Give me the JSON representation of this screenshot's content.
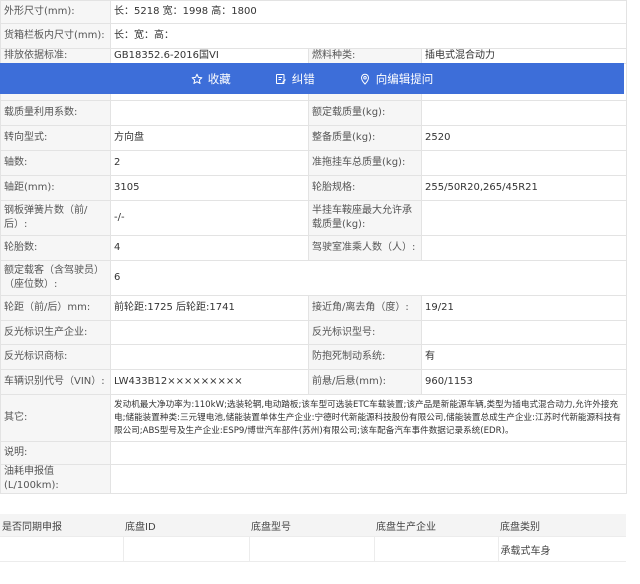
{
  "rows": [
    {
      "l1": "外形尺寸(mm):",
      "v1": "长：5218 宽：1998 高：1800"
    },
    {
      "l1": "货箱栏板内尺寸(mm):",
      "v1": "长：宽：高："
    },
    {
      "l1": "排放依据标准:",
      "v1": "GB18352.6-2016国VI",
      "l2": "燃料种类:",
      "v2": "插电式混合动力"
    },
    {
      "l1": "",
      "v1": "",
      "l2": "",
      "v2": ""
    },
    {
      "l1": "载质量利用系数:",
      "v1": "",
      "l2": "额定载质量(kg):",
      "v2": ""
    },
    {
      "l1": "转向型式:",
      "v1": "方向盘",
      "l2": "整备质量(kg):",
      "v2": "2520"
    },
    {
      "l1": "轴数:",
      "v1": "2",
      "l2": "准拖挂车总质量(kg):",
      "v2": ""
    },
    {
      "l1": "轴距(mm):",
      "v1": "3105",
      "l2": "轮胎规格:",
      "v2": "255/50R20,265/45R21"
    },
    {
      "l1": "钢板弹簧片数（前/后）:",
      "v1": "-/-",
      "l2": "半挂车鞍座最大允许承载质量(kg):",
      "v2": ""
    },
    {
      "l1": "轮胎数:",
      "v1": "4",
      "l2": "驾驶室准乘人数（人）:",
      "v2": ""
    },
    {
      "l1": "额定载客（含驾驶员）（座位数）:",
      "v1": "6"
    },
    {
      "l1": "轮距（前/后）mm:",
      "v1": "前轮距:1725 后轮距:1741",
      "l2": "接近角/离去角（度）:",
      "v2": "19/21"
    },
    {
      "l1": "反光标识生产企业:",
      "v1": "",
      "l2": "反光标识型号:",
      "v2": ""
    },
    {
      "l1": "反光标识商标:",
      "v1": "",
      "l2": "防抱死制动系统:",
      "v2": "有"
    },
    {
      "l1": "车辆识别代号（VIN）:",
      "v1": "LW433B12×××××××××",
      "l2": "前悬/后悬(mm):",
      "v2": "960/1153"
    },
    {
      "l1": "其它:",
      "v1": "发动机最大净功率为:110kW;选装轮辋,电动踏板;该车型可选装ETC车载装置;该产品是新能源车辆,类型为插电式混合动力,允许外接充电;储能装置种类:三元锂电池,储能装置单体生产企业:宁德时代新能源科技股份有限公司,储能装置总成生产企业:江苏时代新能源科技有限公司;ABS型号及生产企业:ESP9/博世汽车部件(苏州)有限公司;该车配备汽车事件数据记录系统(EDR)。"
    },
    {
      "l1": "说明:",
      "v1": ""
    },
    {
      "l1": "油耗申报值(L/100km):",
      "v1": ""
    }
  ],
  "toolbar": {
    "favorite": "收藏",
    "correct": "纠错",
    "ask": "向编辑提问"
  },
  "chassis": {
    "headers": [
      "是否同期申报",
      "底盘ID",
      "底盘型号",
      "底盘生产企业",
      "底盘类别"
    ],
    "row": [
      "",
      "",
      "",
      "",
      "承载式车身"
    ]
  }
}
